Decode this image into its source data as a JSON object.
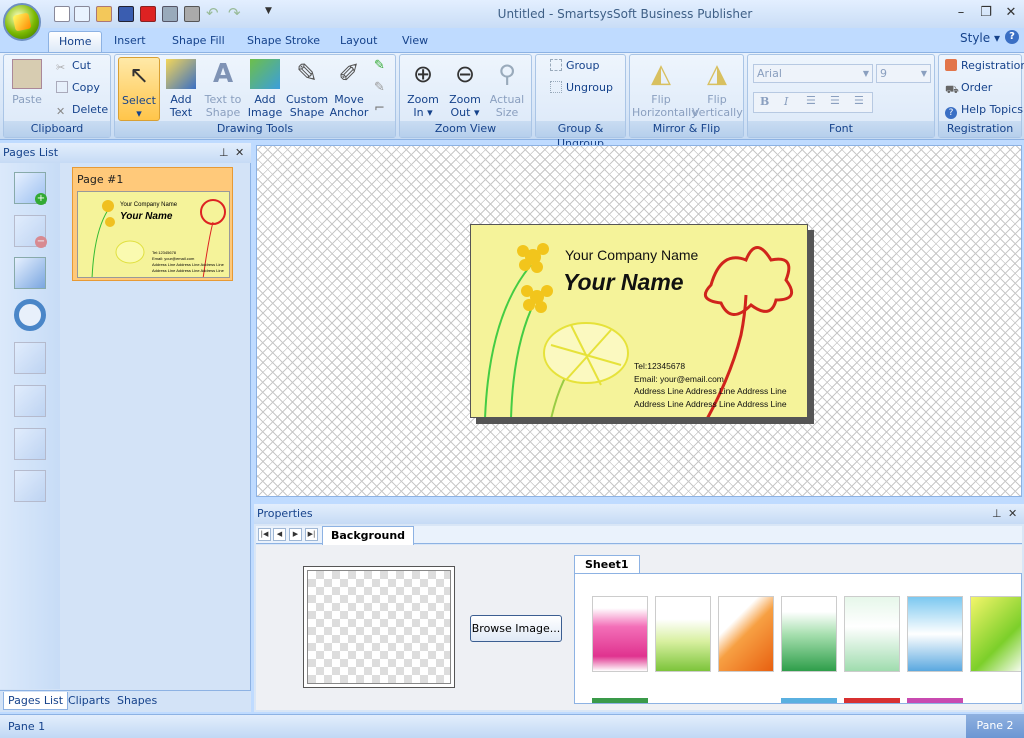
{
  "window": {
    "title": "Untitled - SmartsysSoft Business Publisher"
  },
  "tabs": [
    "Home",
    "Insert",
    "Shape Fill",
    "Shape Stroke",
    "Layout",
    "View"
  ],
  "style_menu": "Style",
  "ribbon": {
    "clipboard": {
      "caption": "Clipboard",
      "paste": "Paste",
      "cut": "Cut",
      "copy": "Copy",
      "delete": "Delete"
    },
    "drawing_tools": {
      "caption": "Drawing Tools",
      "select": "Select",
      "add_text_1": "Add",
      "add_text_2": "Text",
      "text_to_shape_1": "Text to",
      "text_to_shape_2": "Shape",
      "add_image_1": "Add",
      "add_image_2": "Image",
      "custom_shape_1": "Custom",
      "custom_shape_2": "Shape",
      "move_anchor_1": "Move",
      "move_anchor_2": "Anchor"
    },
    "zoom_view": {
      "caption": "Zoom View",
      "zoom_in_1": "Zoom",
      "zoom_in_2": "In",
      "zoom_out_1": "Zoom",
      "zoom_out_2": "Out",
      "actual_1": "Actual",
      "actual_2": "Size"
    },
    "group_ungroup": {
      "caption": "Group & Ungroup",
      "group": "Group",
      "ungroup": "Ungroup"
    },
    "mirror_flip": {
      "caption": "Mirror & Flip",
      "flip_h_1": "Flip",
      "flip_h_2": "Horizontally",
      "flip_v_1": "Flip",
      "flip_v_2": "Vertically"
    },
    "font": {
      "caption": "Font",
      "family": "Arial",
      "size": "9",
      "bold": "B",
      "italic": "I"
    },
    "registration": {
      "caption": "Registration",
      "registration": "Registration",
      "order": "Order",
      "help": "Help Topics"
    }
  },
  "pages_list": {
    "title": "Pages List",
    "page_label": "Page #1"
  },
  "left_tabs": [
    "Pages List",
    "Cliparts",
    "Shapes"
  ],
  "card": {
    "company": "Your Company Name",
    "name": "Your Name",
    "tel": "Tel:12345678",
    "email": "Email: your@email.com",
    "addr1": "Address Line  Address Line Address Line",
    "addr2": "Address Line  Address Line Address Line"
  },
  "properties": {
    "title": "Properties",
    "tab": "Background",
    "browse": "Browse Image...",
    "sheet": "Sheet1"
  },
  "status": {
    "pane1": "Pane 1",
    "pane2": "Pane 2"
  },
  "colors": {
    "ribbon": "#d6e5f7",
    "card": "#f5f39a",
    "accent": "#15428b"
  }
}
